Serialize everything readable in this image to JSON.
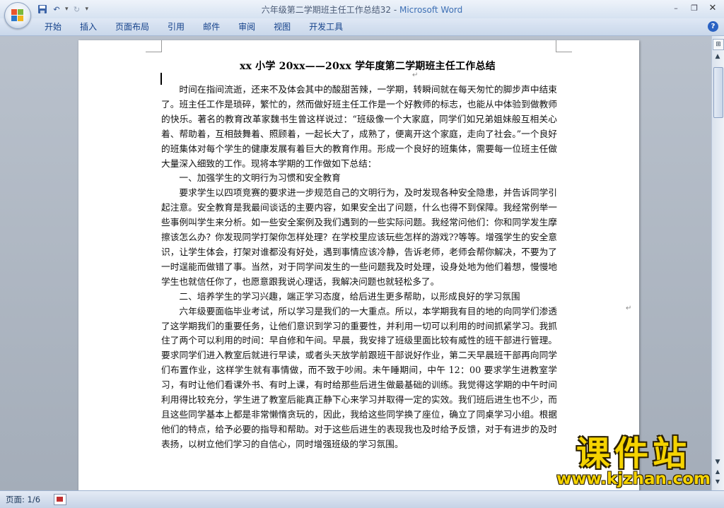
{
  "window": {
    "doc_name": "六年级第二学期班主任工作总结32",
    "separator": " - ",
    "app_name": "Microsoft Word"
  },
  "ribbon": {
    "tabs": [
      "开始",
      "插入",
      "页面布局",
      "引用",
      "邮件",
      "审阅",
      "视图",
      "开发工具"
    ]
  },
  "document": {
    "title": "xx 小学 20xx——20xx 学年度第二学期班主任工作总结",
    "paragraphs": [
      "时间在指间流逝，还来不及体会其中的酸甜苦辣，一学期，转瞬间就在每天匆忙的脚步声中结束了。班主任工作是琐碎，繁忙的，然而做好班主任工作是一个好教师的标志，也能从中体验到做教师的快乐。著名的教育改革家魏书生曾这样说过：“班级像一个大家庭，同学们如兄弟姐妹般互相关心着、帮助着，互相鼓舞着、照顾着，一起长大了，成熟了，便离开这个家庭，走向了社会。”一个良好的班集体对每个学生的健康发展有着巨大的教育作用。形成一个良好的班集体，需要每一位班主任做大量深入细致的工作。现将本学期的工作做如下总结：",
      "一、加强学生的文明行为习惯和安全教育",
      "要求学生以四项竞赛的要求进一步规范自己的文明行为，及时发现各种安全隐患，并告诉同学引起注意。安全教育是我最间谈话的主要内容，如果安全出了问题，什么也得不到保障。我经常例举一些事例叫学生来分析。如一些安全案例及我们遇到的一些实际问题。我经常问他们：你和同学发生摩擦该怎么办？你发现同学打架你怎样处理？在学校里应该玩些怎样的游戏??等等。增强学生的安全意识，让学生体会，打架对谁都没有好处，遇到事情应该冷静，告诉老师，老师会帮你解决，不要为了一时逞能而做错了事。当然，对于同学间发生的一些问题我及时处理，设身处地为他们着想，慢慢地学生也就信任你了，也愿意跟我说心理话，我解决问题也就轻松多了。",
      "二、培养学生的学习兴趣，端正学习态度，给后进生更多帮助，以形成良好的学习氛围",
      "六年级要面临毕业考试，所以学习是我们的一大重点。所以，本学期我有目的地的向同学们渗透了这学期我们的重要任务，让他们意识到学习的重要性，并利用一切可以利用的时间抓紧学习。我抓住了两个可以利用的时间：早自修和午间。早晨，我安排了班级里面比较有威性的班干部进行管理。要求同学们进入教室后就进行早读，或者头天放学前跟班干部说好作业，第二天早晨班干部再向同学们布置作业，这样学生就有事情做，而不致于吵闹。未午睡期间，中午 12：00 要求学生进教室学习，有时让他们看课外书、有时上课，有时给那些后进生做最基础的训练。我觉得这学期的中午时间利用得比较充分，学生进了教室后能真正静下心来学习并取得一定的实效。我们班后进生也不少，而且这些同学基本上都是非常懒惰贪玩的，因此，我给这些同学换了座位，确立了同桌学习小组。根据他们的特点，给予必要的指导和帮助。对于这些后进生的表现我也及时给予反馈，对于有进步的及时表扬，以树立他们学习的自信心，同时增强班级的学习氛围。"
    ]
  },
  "status": {
    "page": "页面: 1/6"
  },
  "watermark": {
    "logo": "课件站",
    "url": "www.kjzhan.com"
  },
  "colors": {
    "tab_text": "#15428b",
    "title_app": "#3d6fb4",
    "watermark": "#f5d300"
  }
}
